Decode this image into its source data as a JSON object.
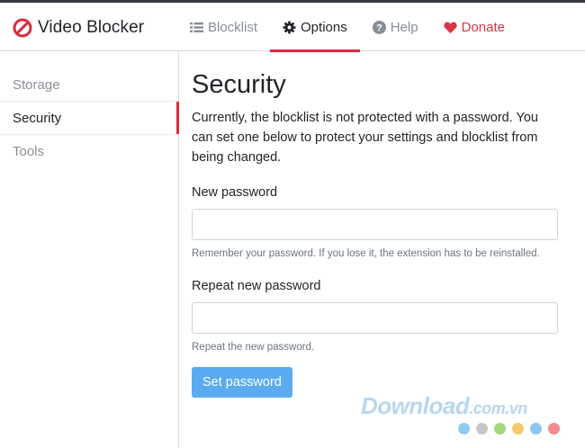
{
  "app": {
    "title": "Video Blocker",
    "accent_color": "#e0283c"
  },
  "nav": {
    "items": [
      {
        "label": "Blocklist",
        "icon": "list-icon"
      },
      {
        "label": "Options",
        "icon": "gear-icon",
        "active": true
      },
      {
        "label": "Help",
        "icon": "question-circle-icon"
      },
      {
        "label": "Donate",
        "icon": "heart-icon",
        "color": "#dc3545"
      }
    ]
  },
  "sidebar": {
    "items": [
      {
        "label": "Storage"
      },
      {
        "label": "Security",
        "active": true
      },
      {
        "label": "Tools"
      }
    ]
  },
  "main": {
    "title": "Security",
    "intro": "Currently, the blocklist is not protected with a password. You can set one below to protect your settings and blocklist from being changed.",
    "new_password": {
      "label": "New password",
      "value": "",
      "help": "Remember your password. If you lose it, the extension has to be reinstalled."
    },
    "repeat_password": {
      "label": "Repeat new password",
      "value": "",
      "help": "Repeat the new password."
    },
    "submit_label": "Set password",
    "submit_color": "#5aabf0"
  },
  "watermark": {
    "text": "Download",
    "suffix": ".com.vn",
    "dot_colors": [
      "#8ecdf0",
      "#c7c7c7",
      "#a3d97a",
      "#f5c96b",
      "#8cc6f2",
      "#f28b8b"
    ]
  }
}
